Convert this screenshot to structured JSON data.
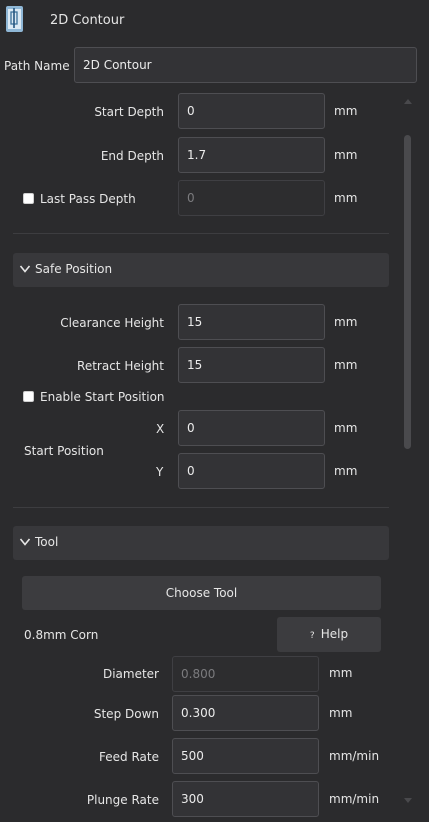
{
  "header": {
    "title": "2D Contour",
    "icon": "contour-tool-icon"
  },
  "path_name": {
    "label": "Path Name",
    "value": "2D Contour"
  },
  "depth": {
    "start_depth": {
      "label": "Start Depth",
      "value": "0",
      "unit": "mm"
    },
    "end_depth": {
      "label": "End Depth",
      "value": "1.7",
      "unit": "mm"
    },
    "last_pass": {
      "label": "Last Pass Depth",
      "value": "0",
      "unit": "mm",
      "checked": false
    }
  },
  "safe_position": {
    "header": "Safe Position",
    "clearance": {
      "label": "Clearance Height",
      "value": "15",
      "unit": "mm"
    },
    "retract": {
      "label": "Retract Height",
      "value": "15",
      "unit": "mm"
    },
    "enable_start": {
      "label": "Enable Start Position",
      "checked": false
    },
    "start_position": {
      "label": "Start Position",
      "x": {
        "label": "X",
        "value": "0",
        "unit": "mm"
      },
      "y": {
        "label": "Y",
        "value": "0",
        "unit": "mm"
      }
    }
  },
  "tool": {
    "header": "Tool",
    "choose_label": "Choose Tool",
    "tool_name": "0.8mm Corn",
    "help_icon": "?",
    "help_label": "Help",
    "diameter": {
      "label": "Diameter",
      "value": "0.800",
      "unit": "mm"
    },
    "step_down": {
      "label": "Step Down",
      "value": "0.300",
      "unit": "mm"
    },
    "feed_rate": {
      "label": "Feed Rate",
      "value": "500",
      "unit": "mm/min"
    },
    "plunge_rate": {
      "label": "Plunge Rate",
      "value": "300",
      "unit": "mm/min"
    }
  },
  "colors": {
    "background": "#2b2b2d",
    "field": "#333336",
    "section": "#38383b",
    "button": "#3c3c3f"
  }
}
